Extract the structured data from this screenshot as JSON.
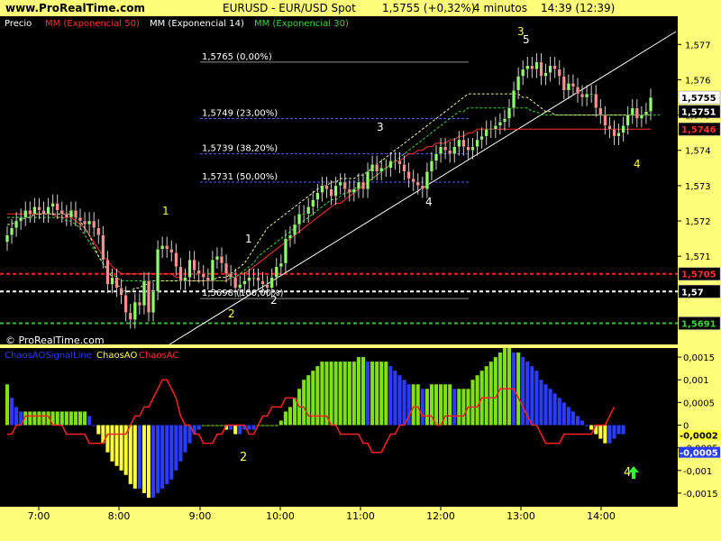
{
  "header": {
    "site": "www.ProRealTime.com",
    "symbol": "EURUSD - EUR/USD Spot",
    "price": "1,5755 (+0,32%)",
    "interval": "4 minutos",
    "time": "14:39 (12:39)"
  },
  "price_panel": {
    "legend": [
      {
        "label": "Precio",
        "color": "#ffffff"
      },
      {
        "label": "MM (Exponencial 50)",
        "color": "#ff3030"
      },
      {
        "label": "MM (Exponencial 14)",
        "color": "#ffffff"
      },
      {
        "label": "MM (Exponencial 30)",
        "color": "#38d838"
      }
    ],
    "watermark": "© ProRealTime.com",
    "y_ticks": [
      "1,577",
      "1,576",
      "1,575",
      "1,574",
      "1,573",
      "1,572",
      "1,571"
    ],
    "price_tags": [
      {
        "text": "1,5755",
        "value": 1.5755,
        "bg": "#ffffff",
        "fg": "#000000"
      },
      {
        "text": "1,5751",
        "value": 1.5751,
        "bg": "#000000",
        "fg": "#ffffff"
      },
      {
        "text": "1,5746",
        "value": 1.5746,
        "bg": "#000000",
        "fg": "#ff3030"
      },
      {
        "text": "1,5705",
        "value": 1.5705,
        "bg": "#000000",
        "fg": "#ff3030"
      },
      {
        "text": "1,57",
        "value": 1.57,
        "bg": "#000000",
        "fg": "#ffffff"
      },
      {
        "text": "1,5691",
        "value": 1.5691,
        "bg": "#000000",
        "fg": "#38d838"
      }
    ],
    "horizontal_lines": [
      {
        "value": 1.5705,
        "color": "#ff2020"
      },
      {
        "value": 1.57,
        "color": "#ffffff"
      },
      {
        "value": 1.5691,
        "color": "#30c030"
      }
    ],
    "fib_levels": [
      {
        "label": "1,5765 (0,00%)",
        "value": 1.5765,
        "color": "#909090"
      },
      {
        "label": "1,5749 (23,00%)",
        "value": 1.5749,
        "color": "#5060ff"
      },
      {
        "label": "1,5739 (38,20%)",
        "value": 1.5739,
        "color": "#5060ff"
      },
      {
        "label": "1,5731 (50,00%)",
        "value": 1.5731,
        "color": "#5060ff"
      },
      {
        "label": "1,5698 (100,00%)",
        "value": 1.5698,
        "color": "#909090"
      }
    ],
    "wave_labels": [
      {
        "text": "1",
        "color": "#ffff40"
      },
      {
        "text": "2",
        "color": "#ffff40"
      },
      {
        "text": "1",
        "color": "#ffffff"
      },
      {
        "text": "2",
        "color": "#ffffff"
      },
      {
        "text": "3",
        "color": "#ffffff"
      },
      {
        "text": "4",
        "color": "#ffffff"
      },
      {
        "text": "3",
        "color": "#ffff40"
      },
      {
        "text": "5",
        "color": "#ffffff"
      },
      {
        "text": "4",
        "color": "#ffff40"
      }
    ]
  },
  "oscillator_panel": {
    "legend": [
      {
        "label": "ChaosAOSignalLine",
        "color": "#2a3cff"
      },
      {
        "label": "ChaosAO",
        "color": "#ffff40"
      },
      {
        "label": "ChaosAC",
        "color": "#ff3030"
      }
    ],
    "y_ticks": [
      "0,0015",
      "0,001",
      "0,0005",
      "0",
      "-0,0005",
      "-0,001",
      "-0,0015"
    ],
    "value_tags": [
      {
        "text": "-0,0002",
        "bg": "#ffff40",
        "fg": "#000000"
      },
      {
        "text": "-0,0005",
        "bg": "#2a3cff",
        "fg": "#ffffff"
      }
    ],
    "labels": [
      {
        "text": "2",
        "color": "#ffff40"
      },
      {
        "text": "4",
        "color": "#ffff40"
      }
    ],
    "arrow_icon": "up-arrow-icon"
  },
  "x_ticks": [
    "7:00",
    "8:00",
    "9:00",
    "10:00",
    "11:00",
    "12:00",
    "13:00",
    "14:00"
  ],
  "chart_data": [
    {
      "type": "candlestick",
      "title": "EURUSD - EUR/USD Spot",
      "ylim": [
        1.5685,
        1.5778
      ],
      "series_names": [
        "Precio",
        "MM (Exponencial 50)",
        "MM (Exponencial 14)",
        "MM (Exponencial 30)"
      ],
      "close": [
        1.5716,
        1.5718,
        1.572,
        1.5721,
        1.5723,
        1.5722,
        1.5724,
        1.5723,
        1.5722,
        1.5724,
        1.5725,
        1.5723,
        1.5722,
        1.5721,
        1.5723,
        1.5721,
        1.572,
        1.5719,
        1.572,
        1.5718,
        1.5716,
        1.5709,
        1.5702,
        1.5704,
        1.5701,
        1.5699,
        1.5694,
        1.5692,
        1.5697,
        1.5696,
        1.5703,
        1.5694,
        1.57,
        1.5712,
        1.5713,
        1.5712,
        1.5711,
        1.5707,
        1.5703,
        1.5704,
        1.5709,
        1.5706,
        1.5705,
        1.5704,
        1.5703,
        1.5709,
        1.571,
        1.5708,
        1.5705,
        1.5704,
        1.5701,
        1.5702,
        1.5703,
        1.5704,
        1.5704,
        1.5703,
        1.5702,
        1.5701,
        1.5704,
        1.5707,
        1.5708,
        1.5715,
        1.5716,
        1.5719,
        1.5722,
        1.5722,
        1.5724,
        1.5726,
        1.5728,
        1.573,
        1.5729,
        1.5727,
        1.573,
        1.5731,
        1.5729,
        1.5728,
        1.5729,
        1.5731,
        1.5729,
        1.5734,
        1.5736,
        1.5734,
        1.5735,
        1.5735,
        1.5737,
        1.5737,
        1.5736,
        1.5734,
        1.5732,
        1.5731,
        1.573,
        1.5729,
        1.5734,
        1.5737,
        1.5739,
        1.5741,
        1.574,
        1.5739,
        1.5741,
        1.5743,
        1.5741,
        1.574,
        1.5741,
        1.5743,
        1.5744,
        1.5746,
        1.5746,
        1.5747,
        1.5748,
        1.5749,
        1.5752,
        1.5757,
        1.5761,
        1.5763,
        1.5764,
        1.5763,
        1.5765,
        1.5761,
        1.5762,
        1.5764,
        1.5763,
        1.5761,
        1.5757,
        1.5759,
        1.5758,
        1.5756,
        1.5755,
        1.5756,
        1.5756,
        1.5752,
        1.575,
        1.5747,
        1.5746,
        1.5744,
        1.5745,
        1.5747,
        1.575,
        1.5752,
        1.5749,
        1.575,
        1.5751,
        1.5755
      ],
      "ema50": [
        1.5722,
        1.5722,
        1.5722,
        1.5722,
        1.5722,
        1.5722,
        1.5722,
        1.5722,
        1.5722,
        1.5722,
        1.5722,
        1.5721,
        1.5721,
        1.5721,
        1.5721,
        1.572,
        1.5719,
        1.5718,
        1.5716,
        1.5714,
        1.5712,
        1.571,
        1.5709,
        1.5707,
        1.5706,
        1.5705,
        1.5705,
        1.5705,
        1.5705,
        1.5705,
        1.5705,
        1.5705,
        1.5705,
        1.5705,
        1.5705,
        1.5705,
        1.5705,
        1.5704,
        1.5704,
        1.5703,
        1.5703,
        1.5703,
        1.5703,
        1.5703,
        1.5703,
        1.5703,
        1.5703,
        1.5703,
        1.5703,
        1.5704,
        1.5704,
        1.5705,
        1.5705,
        1.5706,
        1.5707,
        1.5708,
        1.5709,
        1.571,
        1.5711,
        1.5712,
        1.5713,
        1.5714,
        1.5715,
        1.5716,
        1.5717,
        1.5718,
        1.5719,
        1.572,
        1.5721,
        1.5722,
        1.5723,
        1.5724,
        1.5725,
        1.5725,
        1.5726,
        1.5727,
        1.5728,
        1.5729,
        1.573,
        1.5731,
        1.5732,
        1.5733,
        1.5734,
        1.5735,
        1.5736,
        1.5737,
        1.5737,
        1.5738,
        1.5739,
        1.5739,
        1.574,
        1.574,
        1.5741,
        1.5741,
        1.5742,
        1.5742,
        1.5742,
        1.5743,
        1.5743,
        1.5744,
        1.5744,
        1.5745,
        1.5745,
        1.5746,
        1.5746,
        1.5746,
        1.5746,
        1.5746,
        1.5746,
        1.5746,
        1.5746,
        1.5746,
        1.5746,
        1.5746,
        1.5746,
        1.5746,
        1.5746,
        1.5746,
        1.5746,
        1.5746,
        1.5746,
        1.5746,
        1.5746,
        1.5746,
        1.5746,
        1.5746,
        1.5746,
        1.5746,
        1.5746,
        1.5746,
        1.5746,
        1.5746,
        1.5746,
        1.5746,
        1.5746,
        1.5746,
        1.5746,
        1.5746,
        1.5746,
        1.5746,
        1.5746,
        1.5746
      ],
      "ema14": [
        1.5719,
        1.5719,
        1.572,
        1.572,
        1.5721,
        1.5721,
        1.5722,
        1.5722,
        1.5722,
        1.5722,
        1.5722,
        1.5722,
        1.5722,
        1.5722,
        1.5722,
        1.5721,
        1.572,
        1.5718,
        1.5716,
        1.5713,
        1.571,
        1.5708,
        1.5706,
        1.5704,
        1.5702,
        1.5701,
        1.57,
        1.57,
        1.5701,
        1.5701,
        1.5702,
        1.5702,
        1.5703,
        1.5703,
        1.5703,
        1.5703,
        1.5703,
        1.5703,
        1.5703,
        1.5703,
        1.5703,
        1.5703,
        1.5703,
        1.5703,
        1.5703,
        1.5703,
        1.5704,
        1.5704,
        1.5704,
        1.5705,
        1.5706,
        1.5707,
        1.5708,
        1.571,
        1.5712,
        1.5714,
        1.5716,
        1.5718,
        1.5719,
        1.572,
        1.5721,
        1.5722,
        1.5723,
        1.5724,
        1.5725,
        1.5726,
        1.5727,
        1.5728,
        1.5729,
        1.573,
        1.573,
        1.5731,
        1.5731,
        1.5732,
        1.5732,
        1.5732,
        1.5732,
        1.5733,
        1.5733,
        1.5734,
        1.5735,
        1.5736,
        1.5737,
        1.5738,
        1.5739,
        1.574,
        1.5741,
        1.5742,
        1.5743,
        1.5744,
        1.5745,
        1.5746,
        1.5747,
        1.5748,
        1.5749,
        1.575,
        1.5751,
        1.5752,
        1.5753,
        1.5754,
        1.5755,
        1.5756,
        1.5756,
        1.5756,
        1.5756,
        1.5756,
        1.5756,
        1.5756,
        1.5756,
        1.5756,
        1.5756,
        1.5756,
        1.5756,
        1.5755,
        1.5755,
        1.5754,
        1.5753,
        1.5752,
        1.5751,
        1.5751,
        1.575,
        1.575,
        1.575,
        1.575,
        1.575,
        1.575,
        1.575,
        1.575,
        1.575,
        1.575,
        1.575,
        1.575,
        1.575,
        1.575,
        1.575,
        1.575,
        1.575,
        1.575,
        1.575,
        1.575,
        1.575,
        1.575
      ],
      "ema30": [
        1.5721,
        1.5721,
        1.5721,
        1.5721,
        1.5721,
        1.5721,
        1.5721,
        1.5721,
        1.5721,
        1.5721,
        1.5721,
        1.5721,
        1.5721,
        1.572,
        1.572,
        1.5719,
        1.5718,
        1.5716,
        1.5714,
        1.5712,
        1.571,
        1.5708,
        1.5706,
        1.5705,
        1.5704,
        1.5703,
        1.5703,
        1.5703,
        1.5703,
        1.5703,
        1.5703,
        1.5703,
        1.5703,
        1.5703,
        1.5703,
        1.5703,
        1.5703,
        1.5703,
        1.5703,
        1.5703,
        1.5703,
        1.5703,
        1.5703,
        1.5703,
        1.5703,
        1.5703,
        1.5703,
        1.5703,
        1.5703,
        1.5704,
        1.5704,
        1.5705,
        1.5706,
        1.5707,
        1.5708,
        1.571,
        1.5711,
        1.5712,
        1.5713,
        1.5714,
        1.5715,
        1.5716,
        1.5717,
        1.5718,
        1.5719,
        1.572,
        1.5721,
        1.5722,
        1.5723,
        1.5724,
        1.5725,
        1.5726,
        1.5726,
        1.5727,
        1.5728,
        1.5728,
        1.5729,
        1.573,
        1.573,
        1.5731,
        1.5732,
        1.5733,
        1.5734,
        1.5735,
        1.5736,
        1.5737,
        1.5738,
        1.5739,
        1.574,
        1.5741,
        1.5742,
        1.5743,
        1.5744,
        1.5745,
        1.5746,
        1.5747,
        1.5748,
        1.5749,
        1.575,
        1.5751,
        1.5751,
        1.5752,
        1.5752,
        1.5752,
        1.5752,
        1.5752,
        1.5752,
        1.5752,
        1.5752,
        1.5752,
        1.5752,
        1.5752,
        1.5752,
        1.5752,
        1.5752,
        1.5751,
        1.5751,
        1.575,
        1.575,
        1.575,
        1.575,
        1.575,
        1.575,
        1.575,
        1.575,
        1.575,
        1.575,
        1.575,
        1.575,
        1.575,
        1.575,
        1.575,
        1.575,
        1.575,
        1.575,
        1.575,
        1.575,
        1.575,
        1.575,
        1.575,
        1.575,
        1.575,
        1.575,
        1.575
      ]
    },
    {
      "type": "bar",
      "title": "ChaosAOSignalLine ChaosAO ChaosAC",
      "ylim": [
        -0.0018,
        0.0017
      ],
      "series_names": [
        "ChaosAO",
        "ChaosAOSignalLine",
        "ChaosAC"
      ],
      "ao": [
        0.0009,
        0.0006,
        0.0004,
        0.0003,
        0.0003,
        0.0003,
        0.0003,
        0.0003,
        0.0003,
        0.0003,
        0.0003,
        0.0003,
        0.0003,
        0.0003,
        0.0003,
        0.0003,
        0.0003,
        0.0003,
        0.0002,
        0.0,
        -0.0002,
        -0.0004,
        -0.0006,
        -0.0008,
        -0.0009,
        -0.001,
        -0.0011,
        -0.0013,
        -0.0014,
        -0.0014,
        -0.0015,
        -0.0016,
        -0.0016,
        -0.0015,
        -0.0014,
        -0.0013,
        -0.0012,
        -0.001,
        -0.0008,
        -0.0006,
        -0.0004,
        -0.0002,
        -0.0001,
        0.0,
        0.0,
        0.0,
        0.0,
        0.0,
        -0.0001,
        -0.0001,
        -0.0002,
        -0.0002,
        -0.0001,
        -0.0001,
        -0.0001,
        0.0,
        0.0,
        0.0,
        0.0,
        0.0,
        0.0001,
        0.0003,
        0.0004,
        0.0006,
        0.0008,
        0.001,
        0.0011,
        0.0012,
        0.0013,
        0.0014,
        0.0014,
        0.0014,
        0.0014,
        0.0014,
        0.0014,
        0.0014,
        0.0014,
        0.0015,
        0.0015,
        0.0014,
        0.0014,
        0.0014,
        0.0014,
        0.0014,
        0.0013,
        0.0012,
        0.0011,
        0.001,
        0.0009,
        0.0009,
        0.0009,
        0.0008,
        0.0008,
        0.0009,
        0.0009,
        0.0009,
        0.0009,
        0.0009,
        0.0008,
        0.0008,
        0.0008,
        0.0008,
        0.001,
        0.0011,
        0.0012,
        0.0013,
        0.0014,
        0.0015,
        0.0016,
        0.0017,
        0.0017,
        0.0016,
        0.0016,
        0.0015,
        0.0014,
        0.0013,
        0.0012,
        0.001,
        0.0009,
        0.0008,
        0.0007,
        0.0006,
        0.0005,
        0.0004,
        0.0003,
        0.0002,
        0.0001,
        0.0,
        -0.0001,
        -0.0002,
        -0.0003,
        -0.0004,
        -0.0004,
        -0.0003,
        -0.0002,
        -0.0002
      ],
      "signal": [
        0.0009,
        0.0007,
        0.0005,
        0.0004,
        0.0003,
        0.0003,
        0.0003,
        0.0003,
        0.0003,
        0.0003,
        0.0003,
        0.0003,
        0.0003,
        0.0003,
        0.0003,
        0.0003,
        0.0003,
        0.0003,
        0.0003,
        0.0002,
        0.0001,
        -0.0001,
        -0.0003,
        -0.0005,
        -0.0006,
        -0.0008,
        -0.0009,
        -0.001,
        -0.0011,
        -0.0012,
        -0.0013,
        -0.0014,
        -0.0014,
        -0.0014,
        -0.0014,
        -0.0013,
        -0.0012,
        -0.0011,
        -0.0009,
        -0.0007,
        -0.0005,
        -0.0003,
        -0.0002,
        -0.0001,
        0.0,
        0.0,
        0.0,
        0.0,
        0.0,
        -0.0001,
        -0.0001,
        -0.0002,
        -0.0002,
        -0.0001,
        -0.0001,
        -0.0001,
        0.0,
        0.0,
        0.0,
        0.0,
        0.0001,
        0.0002,
        0.0003,
        0.0005,
        0.0007,
        0.0009,
        0.001,
        0.0011,
        0.0012,
        0.0013,
        0.0014,
        0.0014,
        0.0014,
        0.0014,
        0.0014,
        0.0014,
        0.0014,
        0.0014,
        0.0015,
        0.0015,
        0.0014,
        0.0014,
        0.0014,
        0.0014,
        0.0013,
        0.0013,
        0.0012,
        0.0011,
        0.001,
        0.0009,
        0.0009,
        0.0009,
        0.0008,
        0.0008,
        0.0009,
        0.0009,
        0.0009,
        0.0009,
        0.0008,
        0.0008,
        0.0008,
        0.0008,
        0.0009,
        0.001,
        0.0011,
        0.0012,
        0.0013,
        0.0014,
        0.0015,
        0.0016,
        0.0016,
        0.0016,
        0.0015,
        0.0015,
        0.0014,
        0.0013,
        0.0012,
        0.0011,
        0.001,
        0.0009,
        0.0008,
        0.0007,
        0.0006,
        0.0005,
        0.0004,
        0.0003,
        0.0002,
        0.0001,
        0.0,
        -0.0001,
        -0.0002,
        -0.0003,
        -0.0003,
        -0.0004,
        -0.0004,
        -0.0005
      ],
      "ac": [
        -0.0001,
        -0.0001,
        0.0,
        0.0,
        0.0001,
        0.0001,
        0.0001,
        0.0001,
        0.0001,
        0.0001,
        0.0,
        0.0,
        0.0,
        -0.0001,
        -0.0001,
        -0.0001,
        -0.0001,
        -0.0001,
        -0.0002,
        -0.0002,
        -0.0002,
        -0.0002,
        -0.0001,
        -0.0001,
        -0.0001,
        -0.0001,
        -0.0001,
        0.0,
        0.0001,
        0.0001,
        0.0002,
        0.0002,
        0.0003,
        0.0004,
        0.0005,
        0.0005,
        0.0004,
        0.0003,
        0.0001,
        0.0,
        0.0,
        -0.0001,
        -0.0001,
        -0.0002,
        -0.0002,
        -0.0002,
        -0.0001,
        -0.0001,
        0.0,
        0.0,
        0.0,
        0.0,
        0.0,
        -0.0001,
        -0.0001,
        0.0,
        0.0001,
        0.0001,
        0.0002,
        0.0002,
        0.0002,
        0.0003,
        0.0003,
        0.0003,
        0.0002,
        0.0002,
        0.0001,
        0.0001,
        0.0001,
        0.0001,
        0.0001,
        0.0,
        0.0,
        -0.0001,
        -0.0001,
        -0.0001,
        -0.0001,
        -0.0001,
        -0.0002,
        -0.0002,
        -0.0003,
        -0.0003,
        -0.0003,
        -0.0002,
        -0.0001,
        -0.0001,
        0.0,
        0.0,
        0.0001,
        0.0002,
        0.0002,
        0.0001,
        0.0001,
        0.0001,
        0.0,
        0.0,
        0.0001,
        0.0001,
        0.0001,
        0.0001,
        0.0001,
        0.0002,
        0.0002,
        0.0002,
        0.0003,
        0.0003,
        0.0003,
        0.0003,
        0.0004,
        0.0004,
        0.0004,
        0.0004,
        0.0003,
        0.0002,
        0.0001,
        0.0,
        0.0,
        -0.0001,
        -0.0002,
        -0.0002,
        -0.0002,
        -0.0002,
        -0.0001,
        -0.0001,
        -0.0001,
        -0.0001,
        -0.0001,
        -0.0001,
        -0.0001,
        0.0,
        0.0,
        0.0,
        0.0001,
        0.0002
      ]
    }
  ]
}
